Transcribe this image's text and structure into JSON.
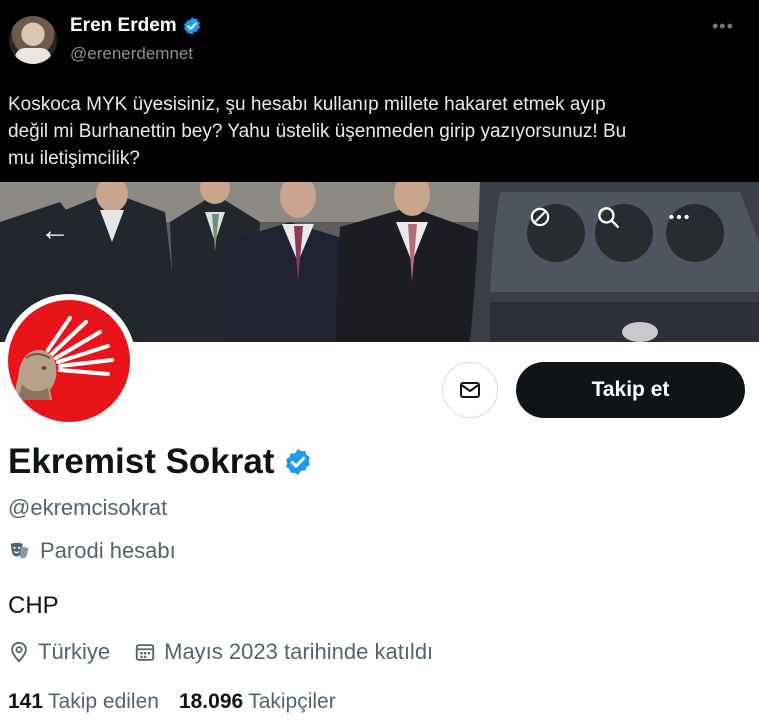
{
  "tweet": {
    "author_name": "Eren Erdem",
    "author_handle": "@erenerdemnet",
    "more_icon": "more-horizontal-icon",
    "text_lines": [
      "Koskoca MYK üyesisiniz, şu hesabı kullanıp millete hakaret etmek ayıp",
      "değil mi Burhanettin bey? Yahu üstelik üşenmeden girip yazıyorsunuz! Bu",
      "mu iletişimcilik?"
    ]
  },
  "profile": {
    "name": "Ekremist Sokrat",
    "handle": "@ekremcisokrat",
    "parody_label": "Parodi hesabı",
    "bio": "CHP",
    "location": "Türkiye",
    "joined": "Mayıs 2023 tarihinde katıldı",
    "following_count": "141",
    "following_label": "Takip edilen",
    "followers_count": "18.096",
    "followers_label": "Takipçiler",
    "follow_button": "Takip et"
  },
  "colors": {
    "verified_blue": "#1d9bf0",
    "party_red": "#e8141a",
    "text_primary": "#0f1419",
    "text_secondary": "#536471"
  }
}
